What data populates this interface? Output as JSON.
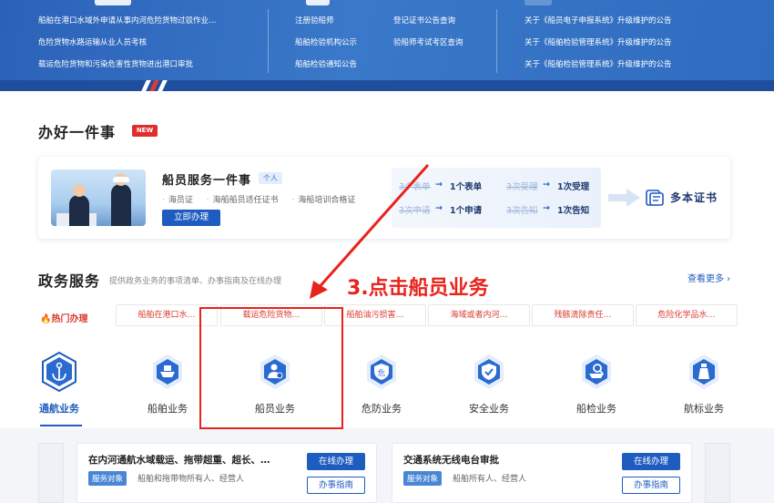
{
  "banner": {
    "columns": [
      {
        "rows": [
          "船舶在港口水域外申请从事内河危险货物过驳作业…",
          "危险货物水路运输从业人员考核",
          "载运危险货物和污染危害性货物进出港口审批"
        ]
      },
      {
        "rows": [
          "注册验船师",
          "船舶检验机构公示",
          "船舶检验通知公告"
        ]
      },
      {
        "rows": [
          "登记证书公告查询",
          "验船师考试考区查询"
        ]
      },
      {
        "rows": [
          "关于《船员电子申报系统》升级维护的公告",
          "关于《船舶检验管理系统》升级维护的公告",
          "关于《船舶检验管理系统》升级维护的公告"
        ]
      }
    ]
  },
  "one_thing": {
    "title": "办好一件事",
    "badge": "NEW",
    "card": {
      "title": "船员服务一件事",
      "tag": "个人",
      "items": [
        "海员证",
        "海船船员适任证书",
        "海船培训合格证"
      ],
      "apply_button": "立即办理",
      "compare": {
        "left": [
          {
            "old": "3个表单",
            "new": "1个表单"
          },
          {
            "old": "3次申请",
            "new": "1个申请"
          }
        ],
        "right": [
          {
            "old": "3次受理",
            "new": "1次受理"
          },
          {
            "old": "3次告知",
            "new": "1次告知"
          }
        ],
        "arrow": "→"
      },
      "result": "多本证书"
    }
  },
  "gov_service": {
    "title": "政务服务",
    "subtitle": "提供政务业务的事项清单、办事指南及在线办理",
    "more": "查看更多 ›",
    "hot_label": "🔥热门办理",
    "hot_items": [
      "船舶在港口水…",
      "载运危险货物…",
      "船舶油污损害…",
      "海域或者内河…",
      "残骸清除责任…",
      "危险化学品水…"
    ],
    "categories": [
      {
        "label": "通航业务",
        "icon": "anchor-icon",
        "active": true
      },
      {
        "label": "船舶业务",
        "icon": "ship-icon",
        "active": false
      },
      {
        "label": "船员业务",
        "icon": "crew-icon",
        "active": false
      },
      {
        "label": "危防业务",
        "icon": "danger-shield-icon",
        "active": false
      },
      {
        "label": "安全业务",
        "icon": "safety-shield-icon",
        "active": false
      },
      {
        "label": "船检业务",
        "icon": "inspection-icon",
        "active": false
      },
      {
        "label": "航标业务",
        "icon": "lighthouse-icon",
        "active": false
      }
    ]
  },
  "service_cards": [
    {
      "title": "在内河通航水域载运、拖带超重、超长、…",
      "object_label": "服务对象",
      "object": "船舶和拖带物所有人、经营人",
      "online": "在线办理",
      "guide": "办事指南"
    },
    {
      "title": "交通系统无线电台审批",
      "object_label": "服务对象",
      "object": "船舶所有人、经营人",
      "online": "在线办理",
      "guide": "办事指南"
    }
  ],
  "annotation": {
    "text": "3.点击船员业务",
    "color": "#e8231c"
  },
  "colors": {
    "primary": "#1f5cbf",
    "hot": "#d93a2f",
    "banner": "#2b62b8"
  }
}
